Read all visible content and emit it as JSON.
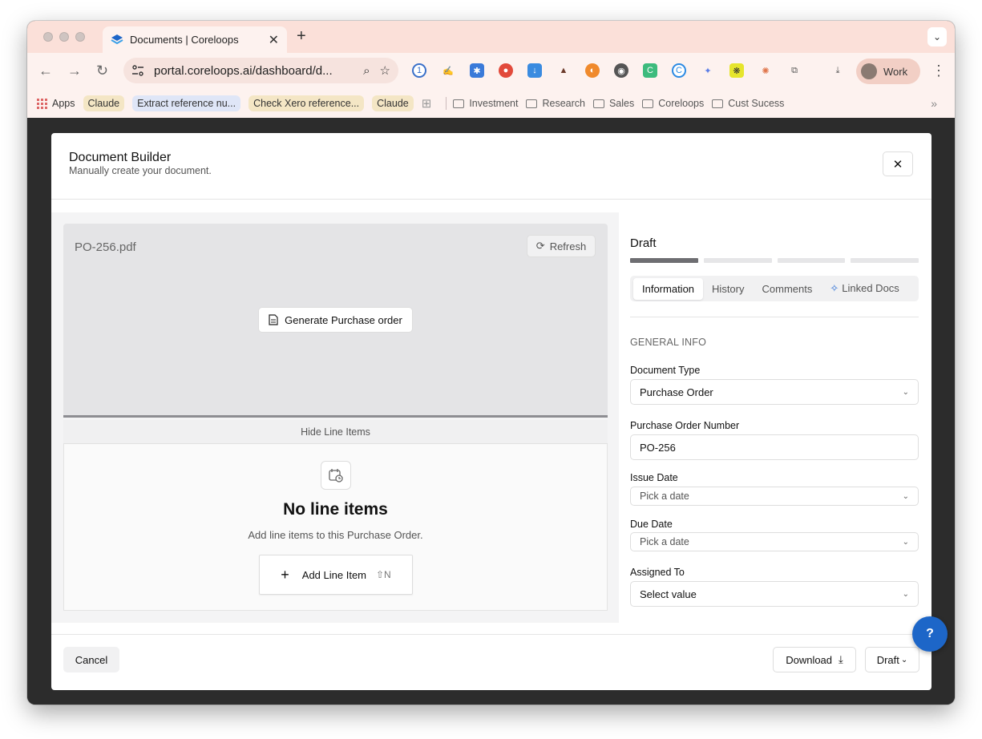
{
  "browser": {
    "tab_title": "Documents | Coreloops",
    "url": "portal.coreloops.ai/dashboard/d...",
    "profile_label": "Work",
    "bookmarks": [
      {
        "label": "Apps",
        "style": "apps"
      },
      {
        "label": "Claude",
        "style": "chip"
      },
      {
        "label": "Extract reference nu...",
        "style": "chip-blue"
      },
      {
        "label": "Check Xero reference...",
        "style": "chip"
      },
      {
        "label": "Claude",
        "style": "chip"
      },
      {
        "label": "Investment",
        "style": "folder"
      },
      {
        "label": "Research",
        "style": "folder"
      },
      {
        "label": "Sales",
        "style": "folder"
      },
      {
        "label": "Coreloops",
        "style": "folder"
      },
      {
        "label": "Cust Sucess",
        "style": "folder"
      }
    ]
  },
  "modal": {
    "title": "Document Builder",
    "subtitle": "Manually create your document.",
    "preview": {
      "filename": "PO-256.pdf",
      "refresh_label": "Refresh",
      "generate_label": "Generate Purchase order"
    },
    "hide_line_items_label": "Hide Line Items",
    "empty_state": {
      "title": "No line items",
      "subtitle": "Add line items to this Purchase Order.",
      "add_label": "Add Line Item",
      "shortcut": "⇧N"
    },
    "status": {
      "label": "Draft",
      "progress_steps": 4,
      "progress_current": 1
    },
    "tabs": [
      "Information",
      "History",
      "Comments",
      "Linked Docs"
    ],
    "active_tab": "Information",
    "section_label": "GENERAL INFO",
    "fields": {
      "document_type": {
        "label": "Document Type",
        "value": "Purchase Order"
      },
      "po_number": {
        "label": "Purchase Order Number",
        "value": "PO-256"
      },
      "issue_date": {
        "label": "Issue Date",
        "placeholder": "Pick a date"
      },
      "due_date": {
        "label": "Due Date",
        "placeholder": "Pick a date"
      },
      "assigned_to": {
        "label": "Assigned To",
        "value": "Select value"
      }
    },
    "footer": {
      "cancel_label": "Cancel",
      "download_label": "Download",
      "draft_label": "Draft"
    }
  },
  "help_label": "?",
  "colors": {
    "accent": "#1d66c8",
    "tabstrip": "#fbe0d9",
    "overlay": "#2c2c2c"
  }
}
